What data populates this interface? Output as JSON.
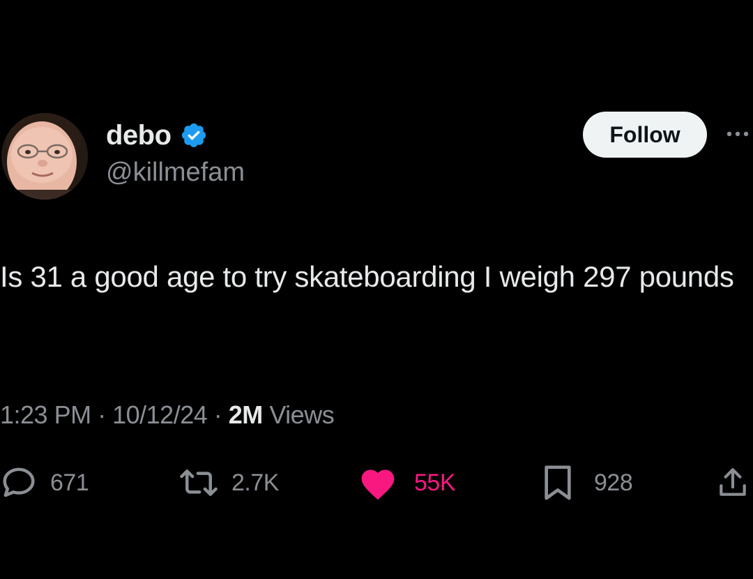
{
  "author": {
    "display_name": "debo",
    "handle": "@killmefam",
    "verified": true
  },
  "follow_button": {
    "label": "Follow"
  },
  "tweet": {
    "text": "Is 31 a good age to try skateboarding I weigh 297 pounds",
    "time": "1:23 PM",
    "separator": "·",
    "date": "10/12/24",
    "views_count": "2M",
    "views_label": "Views"
  },
  "actions": {
    "replies": "671",
    "reposts": "2.7K",
    "likes": "55K",
    "bookmarks": "928"
  },
  "icons": {
    "verified": "verified-badge-icon",
    "more": "more-horizontal-icon",
    "reply": "reply-bubble-icon",
    "repost": "repost-arrows-icon",
    "like": "heart-icon",
    "bookmark": "bookmark-icon",
    "share": "share-upload-icon"
  },
  "colors": {
    "background": "#000000",
    "text_primary": "#e7e9ea",
    "text_secondary": "#8b8f94",
    "verified_blue": "#1d9bf0",
    "like_pink": "#f91880",
    "follow_bg": "#eff3f4"
  }
}
